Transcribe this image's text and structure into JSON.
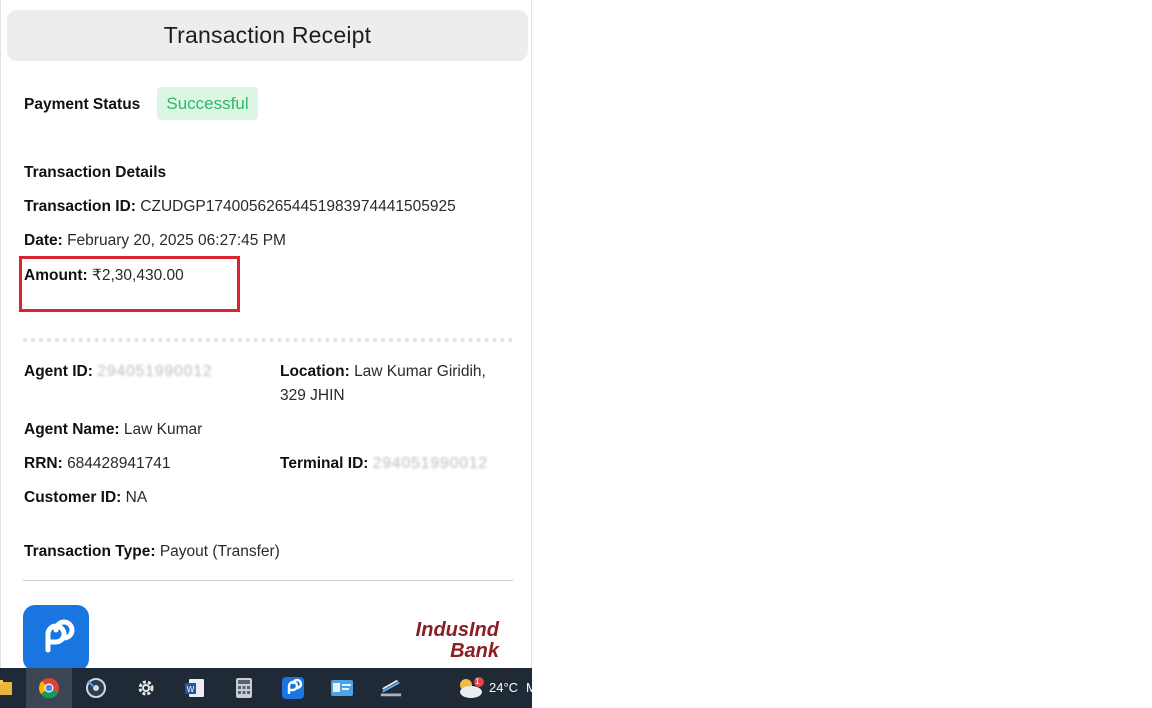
{
  "receipt": {
    "title": "Transaction Receipt",
    "payment_status_label": "Payment Status",
    "payment_status_value": "Successful",
    "section_title": "Transaction Details",
    "transaction_id_label": "Transaction ID:",
    "transaction_id_value": "CZUDGP17400562654451983974441505925",
    "date_label": "Date:",
    "date_value": "February 20, 2025 06:27:45 PM",
    "amount_label": "Amount:",
    "amount_value": "₹2,30,430.00",
    "agent_id_label": "Agent ID:",
    "agent_id_value": "294051990012",
    "location_label": "Location:",
    "location_value_line1": "Law Kumar Giridih,",
    "location_value_line2": "329 JHIN",
    "agent_name_label": "Agent Name:",
    "agent_name_value": "Law Kumar",
    "rrn_label": "RRN:",
    "rrn_value": "684428941741",
    "terminal_id_label": "Terminal ID:",
    "terminal_id_value": "294051990012",
    "customer_id_label": "Customer ID:",
    "customer_id_value": "NA",
    "transaction_type_label": "Transaction Type:",
    "transaction_type_value": "Payout (Transfer)",
    "bank_logo_line1": "IndusInd",
    "bank_logo_line2": "Bank"
  },
  "colors": {
    "success_bg": "#dcf6e4",
    "success_text": "#2fb86a",
    "highlight_border": "#d9232e",
    "app_blue": "#1976e0",
    "bank_maroon": "#8a1f24"
  },
  "taskbar": {
    "icons": [
      "file-explorer-icon",
      "chrome-icon",
      "media-player-icon",
      "settings-gear-icon",
      "word-icon",
      "calculator-icon",
      "payment-app-icon",
      "id-card-icon",
      "scanner-icon",
      "weather-icon"
    ],
    "weather_badge": "1",
    "temperature": "24°C",
    "overflow_text": "M"
  }
}
